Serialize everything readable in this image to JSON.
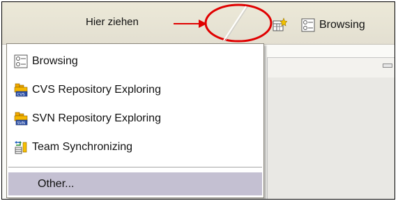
{
  "annotation": {
    "label": "Hier ziehen",
    "color": "#e00000"
  },
  "toolbar": {
    "open_perspective_icon": "open-perspective-icon",
    "current_perspective_label": "Browsing"
  },
  "menu": {
    "items": [
      {
        "label": "Browsing",
        "icon": "browsing-perspective-icon"
      },
      {
        "label": "CVS Repository Exploring",
        "icon": "cvs-repository-icon"
      },
      {
        "label": "SVN Repository Exploring",
        "icon": "svn-repository-icon"
      },
      {
        "label": "Team Synchronizing",
        "icon": "team-synchronizing-icon"
      }
    ],
    "other_label": "Other..."
  }
}
